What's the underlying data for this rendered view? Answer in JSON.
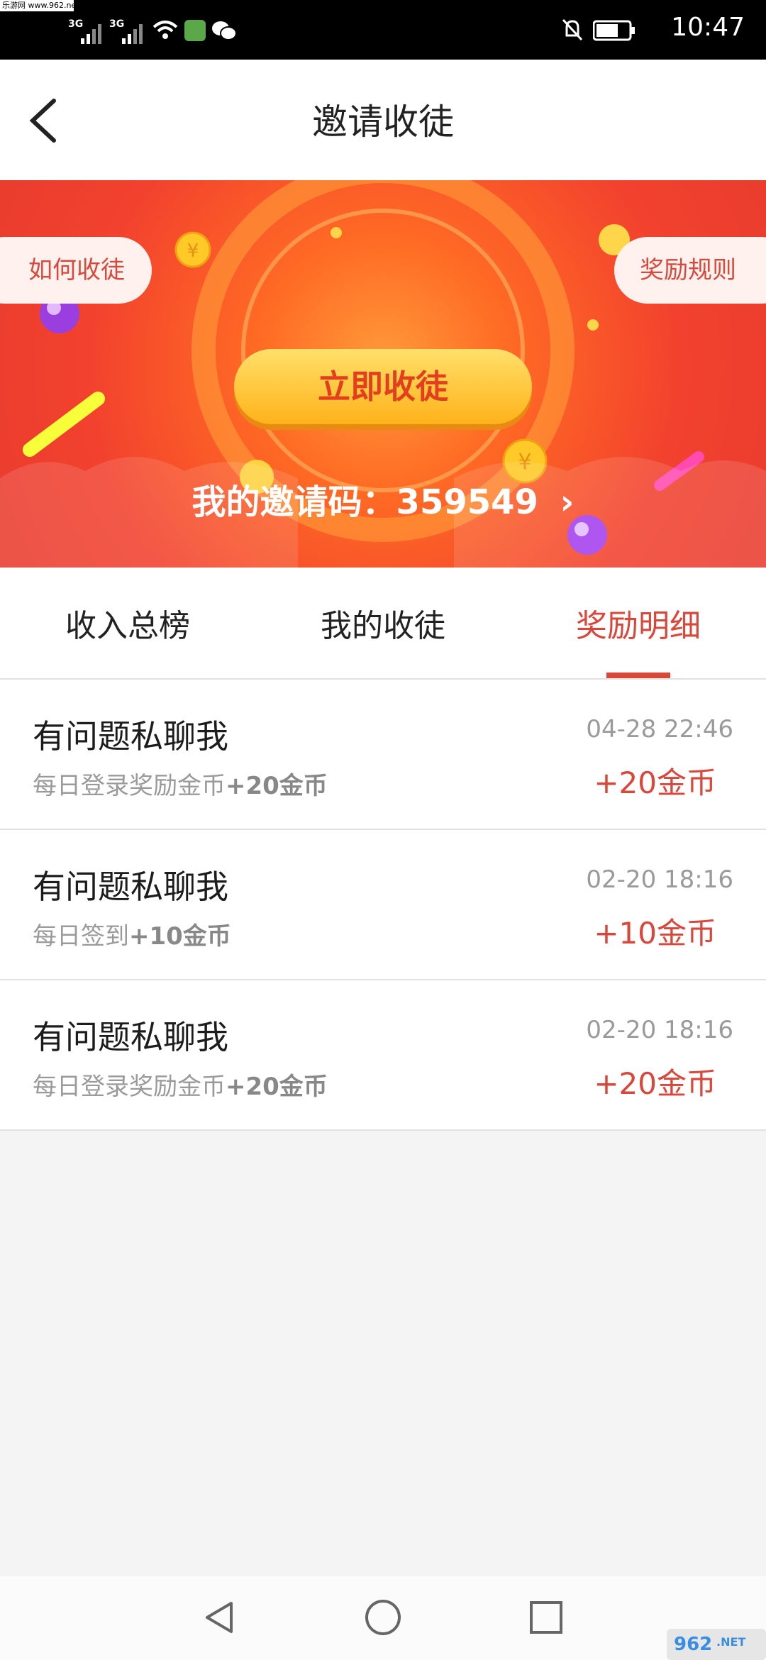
{
  "status_bar": {
    "watermark": "乐游网 www.962.net",
    "signal_1": "3G",
    "signal_2": "3G",
    "time": "10:47"
  },
  "header": {
    "title": "邀请收徒"
  },
  "banner": {
    "how_to_label": "如何收徒",
    "rules_label": "奖励规则",
    "cta_label": "立即收徒",
    "invite_code_text": "我的邀请码：359549",
    "invite_chevron": "›"
  },
  "tabs": [
    {
      "label": "收入总榜",
      "active": false
    },
    {
      "label": "我的收徒",
      "active": false
    },
    {
      "label": "奖励明细",
      "active": true
    }
  ],
  "records": [
    {
      "title": "有问题私聊我",
      "desc": "每日登录奖励金币",
      "desc_bonus": "+20金币",
      "datetime": "04-28 22:46",
      "amount": "+20金币"
    },
    {
      "title": "有问题私聊我",
      "desc": "每日签到",
      "desc_bonus": "+10金币",
      "datetime": "02-20 18:16",
      "amount": "+10金币"
    },
    {
      "title": "有问题私聊我",
      "desc": "每日登录奖励金币",
      "desc_bonus": "+20金币",
      "datetime": "02-20 18:16",
      "amount": "+20金币"
    }
  ],
  "icons": {
    "back": "chevron-left",
    "nav_back": "triangle-back",
    "nav_home": "circle-home",
    "nav_recent": "square-recent"
  },
  "colors": {
    "accent": "#d9463a",
    "banner_red": "#e53a2f",
    "banner_orange": "#ff7a2a",
    "cta_yellow": "#ffc12b"
  },
  "logo_text": "962.NET"
}
